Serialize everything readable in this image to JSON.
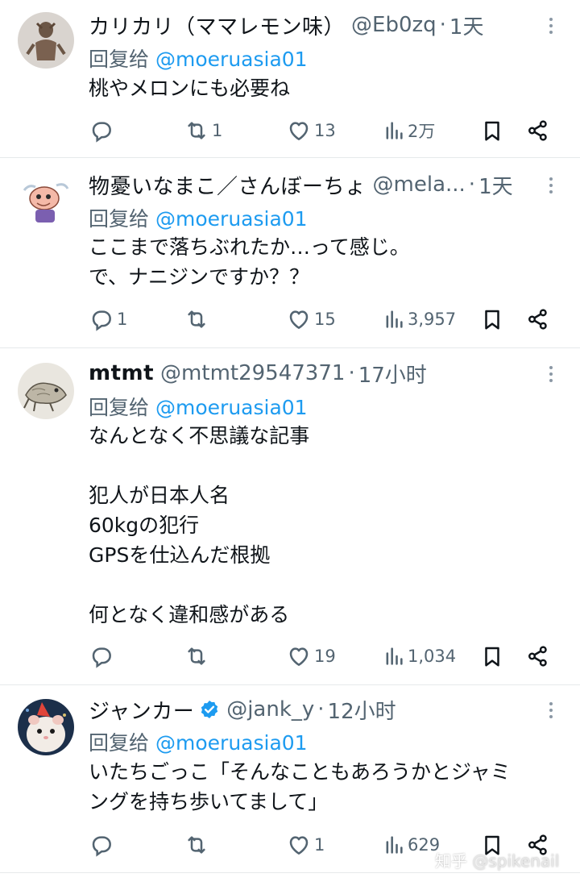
{
  "tweets": [
    {
      "name": "カリカリ（ママレモン味）",
      "handle": "@Eb0zq",
      "dot": "·",
      "time": "1天",
      "reply_prefix": "回复给",
      "reply_to": "@moeruasia01",
      "lines": [
        "桃やメロンにも必要ね"
      ],
      "reply_count": "",
      "retweet_count": "1",
      "like_count": "13",
      "view_count": "2万"
    },
    {
      "name": "物憂いなまこ／さんぼーちょ",
      "handle": "@mela...",
      "dot": "·",
      "time": "1天",
      "reply_prefix": "回复给",
      "reply_to": "@moeruasia01",
      "lines": [
        "ここまで落ちぶれたか…って感じ。",
        "で、ナニジンですか？？"
      ],
      "reply_count": "1",
      "retweet_count": "",
      "like_count": "15",
      "view_count": "3,957"
    },
    {
      "name": "mtmt",
      "handle": "@mtmt29547371",
      "dot": "·",
      "time": "17小时",
      "reply_prefix": "回复给",
      "reply_to": "@moeruasia01",
      "lines": [
        "なんとなく不思議な記事",
        "",
        "犯人が日本人名",
        "60kgの犯行",
        "GPSを仕込んだ根拠",
        "",
        "何となく違和感がある"
      ],
      "reply_count": "",
      "retweet_count": "",
      "like_count": "19",
      "view_count": "1,034"
    },
    {
      "name": "ジャンカー",
      "handle": "@jank_y",
      "dot": "·",
      "time": "12小时",
      "reply_prefix": "回复给",
      "reply_to": "@moeruasia01",
      "lines": [
        "いたちごっこ「そんなこともあろうかとジャミ",
        "ングを持ち歩いてまして」"
      ],
      "reply_count": "",
      "retweet_count": "",
      "like_count": "1",
      "view_count": "629"
    }
  ],
  "watermark": {
    "site": "知乎",
    "user": "@spikenail"
  },
  "colors": {
    "text": "#0f1419",
    "secondary": "#536471",
    "link": "#1d9bf0",
    "divider": "#e6e9eb",
    "verified": "#1d9bf0"
  },
  "icons": [
    "reply-icon",
    "retweet-icon",
    "like-icon",
    "views-icon",
    "bookmark-icon",
    "share-icon",
    "more-icon",
    "verified-badge-icon"
  ]
}
